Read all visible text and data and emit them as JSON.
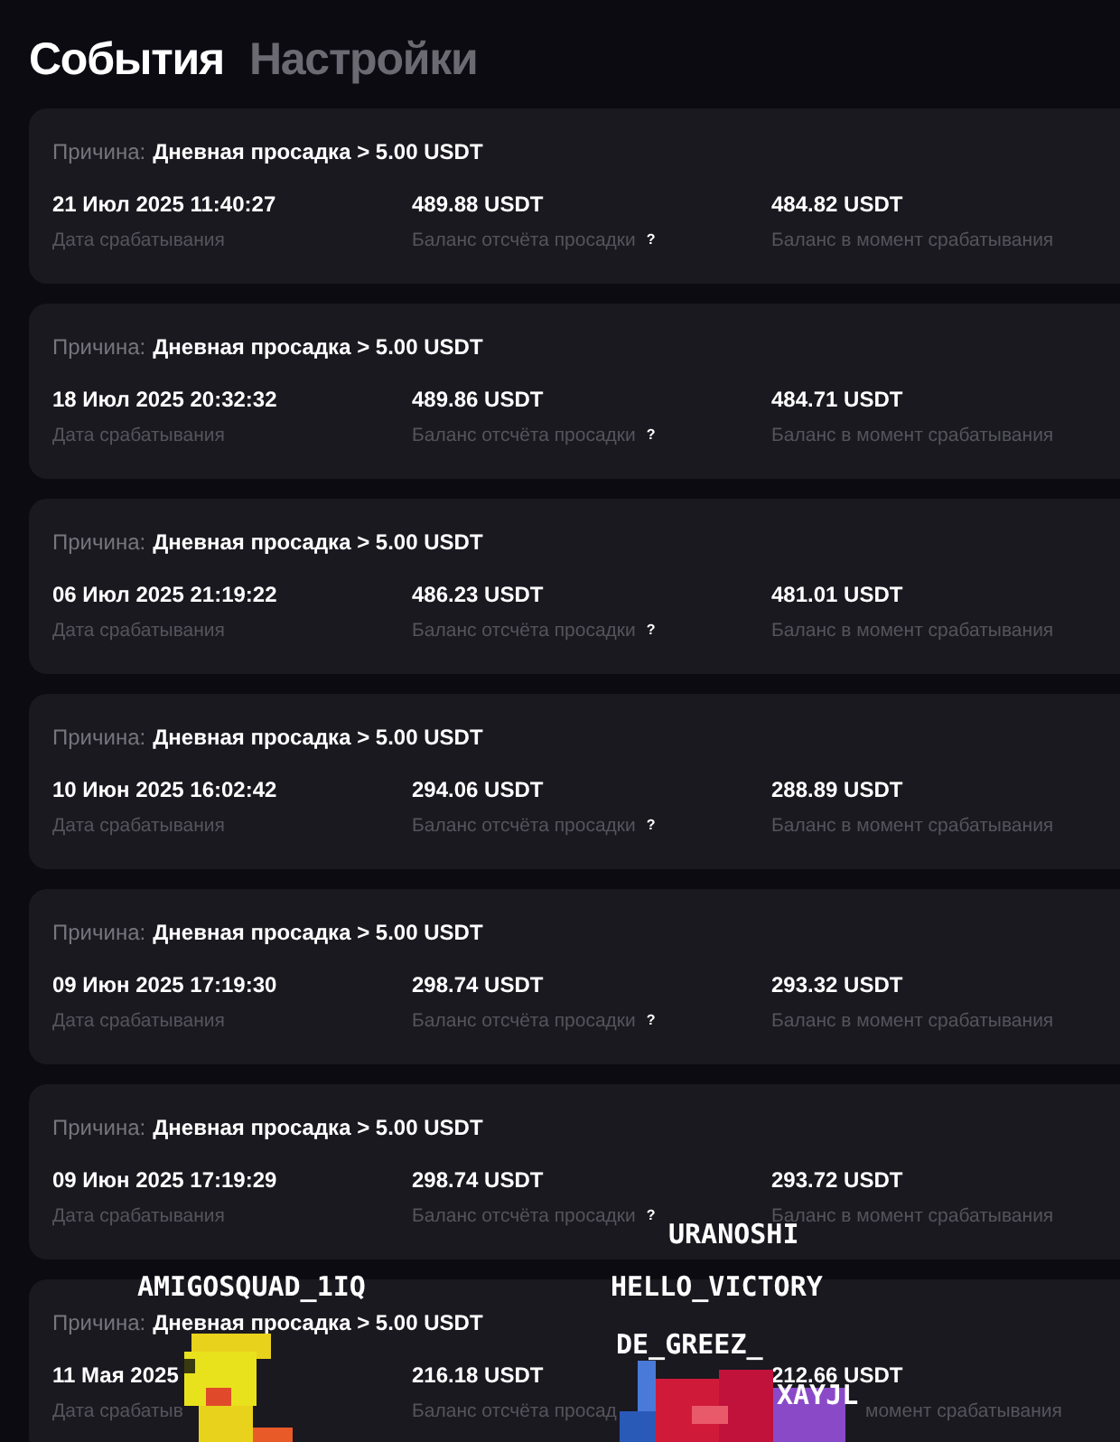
{
  "tabs": [
    {
      "label": "События",
      "selected": true
    },
    {
      "label": "Настройки",
      "selected": false
    }
  ],
  "events": [
    {
      "kind": "full",
      "reason_label": "Причина:",
      "reason": "Дневная просадка > 5.00 USDT",
      "date": "21 Июл 2025 11:40:27",
      "date_label": "Дата срабатывания",
      "base": "489.88 USDT",
      "base_label": "Баланс отсчёта просадки",
      "hint": "?",
      "balance": "484.82 USDT",
      "balance_label": "Баланс в момент срабатывания"
    },
    {
      "kind": "full",
      "reason_label": "Причина:",
      "reason": "Дневная просадка > 5.00 USDT",
      "date": "18 Июл 2025 20:32:32",
      "date_label": "Дата срабатывания",
      "base": "489.86 USDT",
      "base_label": "Баланс отсчёта просадки",
      "hint": "?",
      "balance": "484.71 USDT",
      "balance_label": "Баланс в момент срабатывания"
    },
    {
      "kind": "full",
      "reason_label": "Причина:",
      "reason": "Дневная просадка > 5.00 USDT",
      "date": "06 Июл 2025 21:19:22",
      "date_label": "Дата срабатывания",
      "base": "486.23 USDT",
      "base_label": "Баланс отсчёта просадки",
      "hint": "?",
      "balance": "481.01 USDT",
      "balance_label": "Баланс в момент срабатывания"
    },
    {
      "kind": "full",
      "reason_label": "Причина:",
      "reason": "Дневная просадка > 5.00 USDT",
      "date": "10 Июн 2025 16:02:42",
      "date_label": "Дата срабатывания",
      "base": "294.06 USDT",
      "base_label": "Баланс отсчёта просадки",
      "hint": "?",
      "balance": "288.89 USDT",
      "balance_label": "Баланс в момент срабатывания"
    },
    {
      "kind": "full",
      "reason_label": "Причина:",
      "reason": "Дневная просадка > 5.00 USDT",
      "date": "09 Июн 2025 17:19:30",
      "date_label": "Дата срабатывания",
      "base": "298.74 USDT",
      "base_label": "Баланс отсчёта просадки",
      "hint": "?",
      "balance": "293.32 USDT",
      "balance_label": "Баланс в момент срабатывания"
    },
    {
      "kind": "full",
      "reason_label": "Причина:",
      "reason": "Дневная просадка > 5.00 USDT",
      "date": "09 Июн 2025 17:19:29",
      "date_label": "Дата срабатывания",
      "base": "298.74 USDT",
      "base_label": "Баланс отсчёта просадки",
      "hint": "?",
      "balance": "293.72 USDT",
      "balance_label": "Баланс в момент срабатывания"
    },
    {
      "kind": "covered",
      "reason_label": "Причина:",
      "reason": "Дневная просадка > 5.00 USDT",
      "date": "11 Мая 2025",
      "date_label": "Дата срабатыв",
      "base": "216.18 USDT",
      "base_label": "Баланс отсчёта просад",
      "balance": "212.66 USDT",
      "balance_label": "момент срабатывания"
    }
  ],
  "overlay": {
    "names": [
      "URANOSHI",
      "AMIGOSQUAD_1IQ",
      "HELLO_VICTORY",
      "DE_GREEZ_",
      "XAYJL"
    ]
  }
}
